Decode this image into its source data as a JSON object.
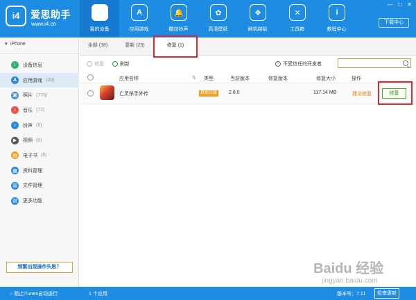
{
  "header": {
    "brand_title": "爱思助手",
    "brand_url": "www.i4.cn",
    "logo_text": "i4",
    "nav": [
      {
        "label": "我的设备",
        "icon": "apple-icon",
        "glyph": ""
      },
      {
        "label": "应用游戏",
        "icon": "app-store-icon",
        "glyph": "A"
      },
      {
        "label": "酷炫铃声",
        "icon": "bell-icon",
        "glyph": "🔔"
      },
      {
        "label": "高清壁纸",
        "icon": "flower-icon",
        "glyph": "✿"
      },
      {
        "label": "刷机越狱",
        "icon": "dropbox-icon",
        "glyph": "❖"
      },
      {
        "label": "工具箱",
        "icon": "tools-icon",
        "glyph": "✕"
      },
      {
        "label": "教程中心",
        "icon": "info-icon",
        "glyph": "i"
      }
    ],
    "download_label": "下载中心",
    "win_controls": [
      "—",
      "□",
      "✕"
    ]
  },
  "sidebar": {
    "device": "iPhone",
    "items": [
      {
        "label": "设备信息",
        "count": "",
        "icon": "info-icon",
        "color": "#2fb46d",
        "glyph": "i"
      },
      {
        "label": "应用游戏",
        "count": "(38)",
        "icon": "app-icon",
        "color": "#2b8ad8",
        "glyph": "A"
      },
      {
        "label": "照片",
        "count": "(776)",
        "icon": "photo-icon",
        "color": "#4a90d9",
        "glyph": "▣"
      },
      {
        "label": "音乐",
        "count": "(72)",
        "icon": "music-icon",
        "color": "#e8534a",
        "glyph": "♪"
      },
      {
        "label": "铃声",
        "count": "(6)",
        "icon": "bell-icon",
        "color": "#2b8ad8",
        "glyph": "♪"
      },
      {
        "label": "视频",
        "count": "(0)",
        "icon": "video-icon",
        "color": "#555555",
        "glyph": "▶"
      },
      {
        "label": "电子书",
        "count": "(6)",
        "icon": "book-icon",
        "color": "#f0a020",
        "glyph": "▤"
      },
      {
        "label": "资料管理",
        "count": "",
        "icon": "contacts-icon",
        "color": "#2b8ad8",
        "glyph": "▦"
      },
      {
        "label": "文件管理",
        "count": "",
        "icon": "file-icon",
        "color": "#2b8ad8",
        "glyph": "▥"
      },
      {
        "label": "更多功能",
        "count": "",
        "icon": "more-icon",
        "color": "#2b8ad8",
        "glyph": "▤"
      }
    ],
    "fail_button": "频繁出现操作失败？"
  },
  "tabs": [
    {
      "label": "全部 (38)"
    },
    {
      "label": "更新 (25)"
    },
    {
      "label": "修复 (1)"
    }
  ],
  "toolbar": {
    "repair": "修复",
    "refresh": "刷新",
    "untrusted": "不受信任的开发者"
  },
  "table": {
    "headers": [
      "应用名称",
      "类型",
      "当前版本",
      "修复版本",
      "修复大小",
      "操作"
    ],
    "row": {
      "name": "亡灵杀手外传",
      "type": "其他正版",
      "current_version": "2.8.0",
      "repair_version": "",
      "size": "117.14 MB",
      "suggest": "建议修复",
      "action": "修复"
    }
  },
  "status": {
    "itunes": "阻止iTunes自动运行",
    "count": "1 个应用",
    "version": "版本号：7.11",
    "check_update": "检查更新"
  },
  "watermark": {
    "main": "Baidu 经验",
    "url": "jingyan.baidu.com"
  },
  "colors": {
    "accent": "#1e8ce3",
    "highlight": "#e0272f",
    "action_green": "#52a52c"
  }
}
